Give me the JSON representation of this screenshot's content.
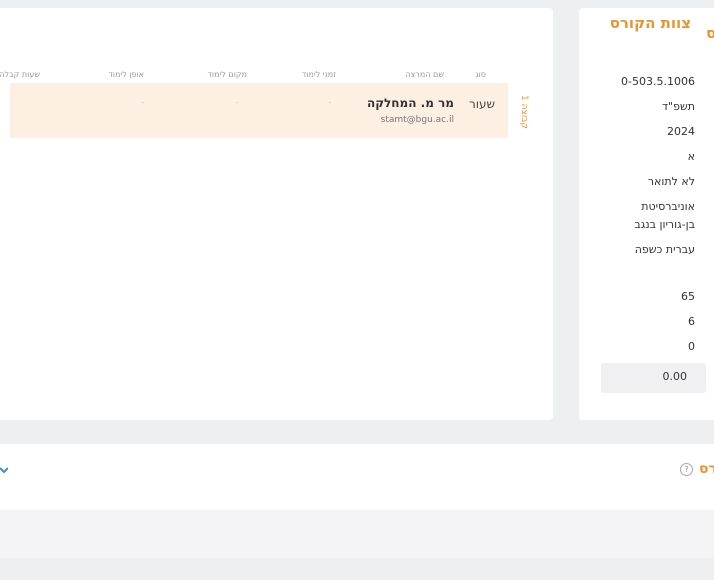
{
  "team": {
    "title": "צוות הקורס",
    "columns": [
      "סוג",
      "שם המרצה",
      "זמני לימוד",
      "מקום לימוד",
      "אופן לימוד",
      "שעות קבלה"
    ],
    "group_label": "קבוצה 1",
    "row": {
      "type": "שעור",
      "name": "מר מ. המחלקה",
      "email": "stamt@bgu.ac.il",
      "time": "-",
      "place": "-",
      "mode": "-"
    }
  },
  "details": {
    "title": "ס",
    "values": [
      "0-503.5.1006",
      "תשפ\"ד",
      "2024",
      "א",
      "לא לתואר",
      "אוניברסיטת",
      "בן-גוריון בנגב",
      "עברית כשפה",
      "65",
      "6",
      "0"
    ],
    "grade": "0.00"
  },
  "syllabus": {
    "title": "רס",
    "help_icon": "?"
  },
  "colors": {
    "accent": "#f0922a",
    "row_highlight": "#fdf0e2",
    "link_icon": "#3a8fd4"
  }
}
